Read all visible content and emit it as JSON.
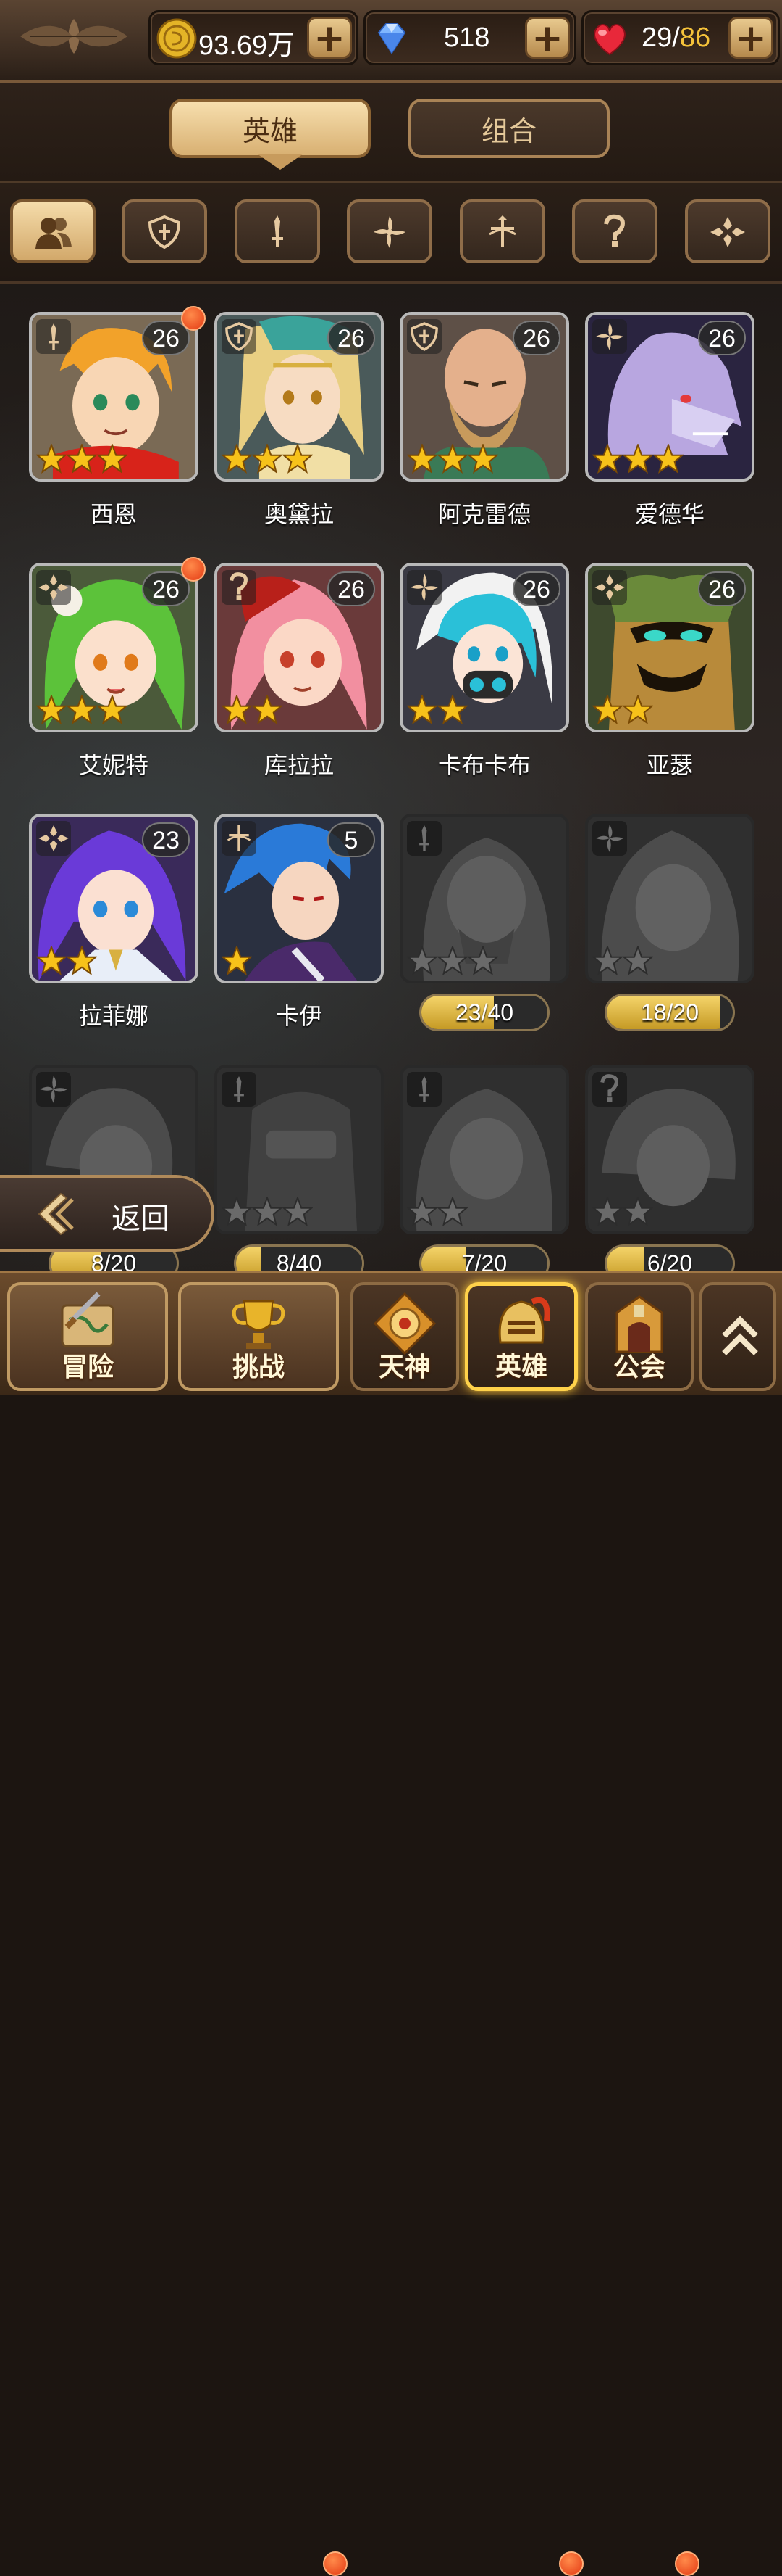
{
  "resources": {
    "gold": {
      "value": "93.69万",
      "icon": "gold-coin-icon"
    },
    "gems": {
      "value": "518",
      "icon": "diamond-icon"
    },
    "stamina": {
      "current": "29",
      "separator": "/",
      "max": "86",
      "icon": "heart-icon"
    }
  },
  "tabs": [
    {
      "label": "英雄",
      "active": true
    },
    {
      "label": "组合",
      "active": false
    }
  ],
  "filters": [
    {
      "icon": "all-heroes-icon",
      "active": true
    },
    {
      "icon": "tank-class-icon",
      "active": false
    },
    {
      "icon": "warrior-class-icon",
      "active": false
    },
    {
      "icon": "assassin-class-icon",
      "active": false
    },
    {
      "icon": "archer-class-icon",
      "active": false
    },
    {
      "icon": "mage-class-icon",
      "active": false
    },
    {
      "icon": "support-class-icon",
      "active": false
    }
  ],
  "heroes": [
    {
      "name": "西恩",
      "level": "26",
      "stars": 3,
      "class": "warrior",
      "dot": true
    },
    {
      "name": "奥黛拉",
      "level": "26",
      "stars": 3,
      "class": "tank",
      "dot": false
    },
    {
      "name": "阿克雷德",
      "level": "26",
      "stars": 3,
      "class": "tank",
      "dot": false
    },
    {
      "name": "爱德华",
      "level": "26",
      "stars": 3,
      "class": "assassin",
      "dot": false
    },
    {
      "name": "艾妮特",
      "level": "26",
      "stars": 3,
      "class": "support",
      "dot": true
    },
    {
      "name": "库拉拉",
      "level": "26",
      "stars": 2,
      "class": "mage",
      "dot": false
    },
    {
      "name": "卡布卡布",
      "level": "26",
      "stars": 2,
      "class": "assassin",
      "dot": false
    },
    {
      "name": "亚瑟",
      "level": "26",
      "stars": 2,
      "class": "support",
      "dot": false
    },
    {
      "name": "拉菲娜",
      "level": "23",
      "stars": 2,
      "class": "support",
      "dot": false
    },
    {
      "name": "卡伊",
      "level": "5",
      "stars": 1,
      "class": "archer",
      "dot": false
    }
  ],
  "locked_heroes": [
    {
      "fragments": "23/40",
      "progress": 0.575,
      "stars": 3,
      "class": "warrior"
    },
    {
      "fragments": "18/20",
      "progress": 0.9,
      "stars": 2,
      "class": "assassin"
    },
    {
      "fragments": "8/20",
      "progress": 0.4,
      "stars": 2,
      "class": "assassin"
    },
    {
      "fragments": "8/40",
      "progress": 0.2,
      "stars": 3,
      "class": "warrior"
    },
    {
      "fragments": "7/20",
      "progress": 0.35,
      "stars": 2,
      "class": "warrior"
    },
    {
      "fragments": "6/20",
      "progress": 0.3,
      "stars": 2,
      "class": "mage"
    }
  ],
  "back_button": {
    "label": "返回"
  },
  "bottom_nav": [
    {
      "label": "冒险",
      "icon": "adventure-map-icon",
      "dot": false,
      "active": false
    },
    {
      "label": "挑战",
      "icon": "challenge-trophy-icon",
      "dot": true,
      "active": false
    },
    {
      "label": "天神",
      "icon": "god-emblem-icon",
      "dot": false,
      "active": false
    },
    {
      "label": "英雄",
      "icon": "hero-helmet-icon",
      "dot": true,
      "active": true
    },
    {
      "label": "公会",
      "icon": "guild-gate-icon",
      "dot": true,
      "active": false
    },
    {
      "label": "",
      "icon": "expand-up-icon",
      "dot": false,
      "active": false
    }
  ],
  "colors": {
    "accent_gold": "#ffd24a",
    "stamina_max": "#f5c23a",
    "notification_dot": "#e43a14",
    "tab_active": "#f7dfae"
  }
}
